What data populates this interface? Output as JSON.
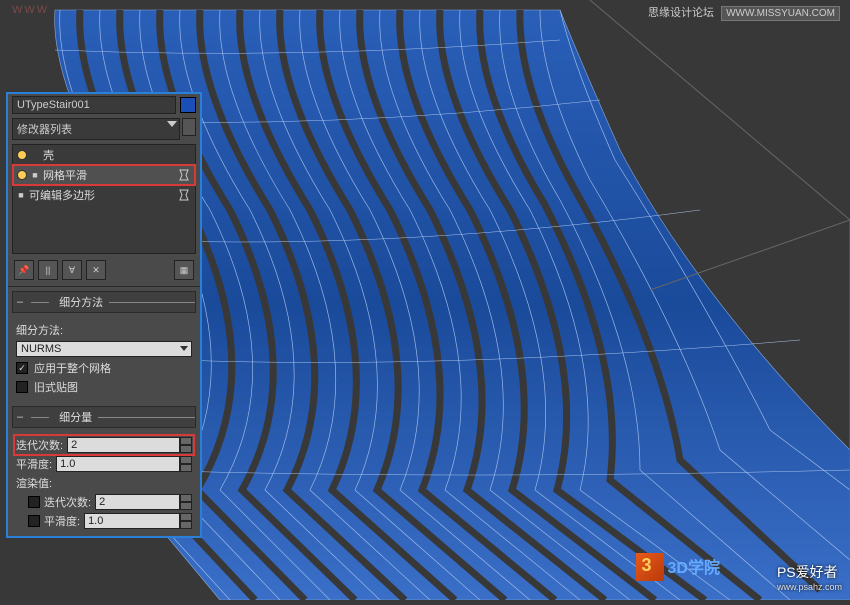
{
  "watermarks": {
    "top_left": "WWW",
    "top_right_text": "思缘设计论坛",
    "top_right_box": "WWW.MISSYUAN.COM",
    "logo3d_text": "3D学院",
    "bottom_right_main": "PS爱好者",
    "bottom_right_sub": "www.psahz.com"
  },
  "panel": {
    "object_name": "UTypeStair001",
    "modifier_list_label": "修改器列表",
    "stack": {
      "item0": "壳",
      "item1": "网格平滑",
      "item2": "可编辑多边形"
    },
    "rollouts": {
      "subdivision_method": {
        "title": "细分方法",
        "method_label": "细分方法:",
        "method_value": "NURMS",
        "apply_whole_mesh": "应用于整个网格",
        "old_style": "旧式贴图"
      },
      "subdivision_amount": {
        "title": "细分量",
        "iterations_label": "迭代次数:",
        "iterations_value": "2",
        "smoothness_label": "平滑度:",
        "smoothness_value": "1.0",
        "render_label": "渲染值:",
        "render_iterations_label": "迭代次数:",
        "render_iterations_value": "2",
        "render_smoothness_label": "平滑度:",
        "render_smoothness_value": "1.0"
      }
    }
  }
}
